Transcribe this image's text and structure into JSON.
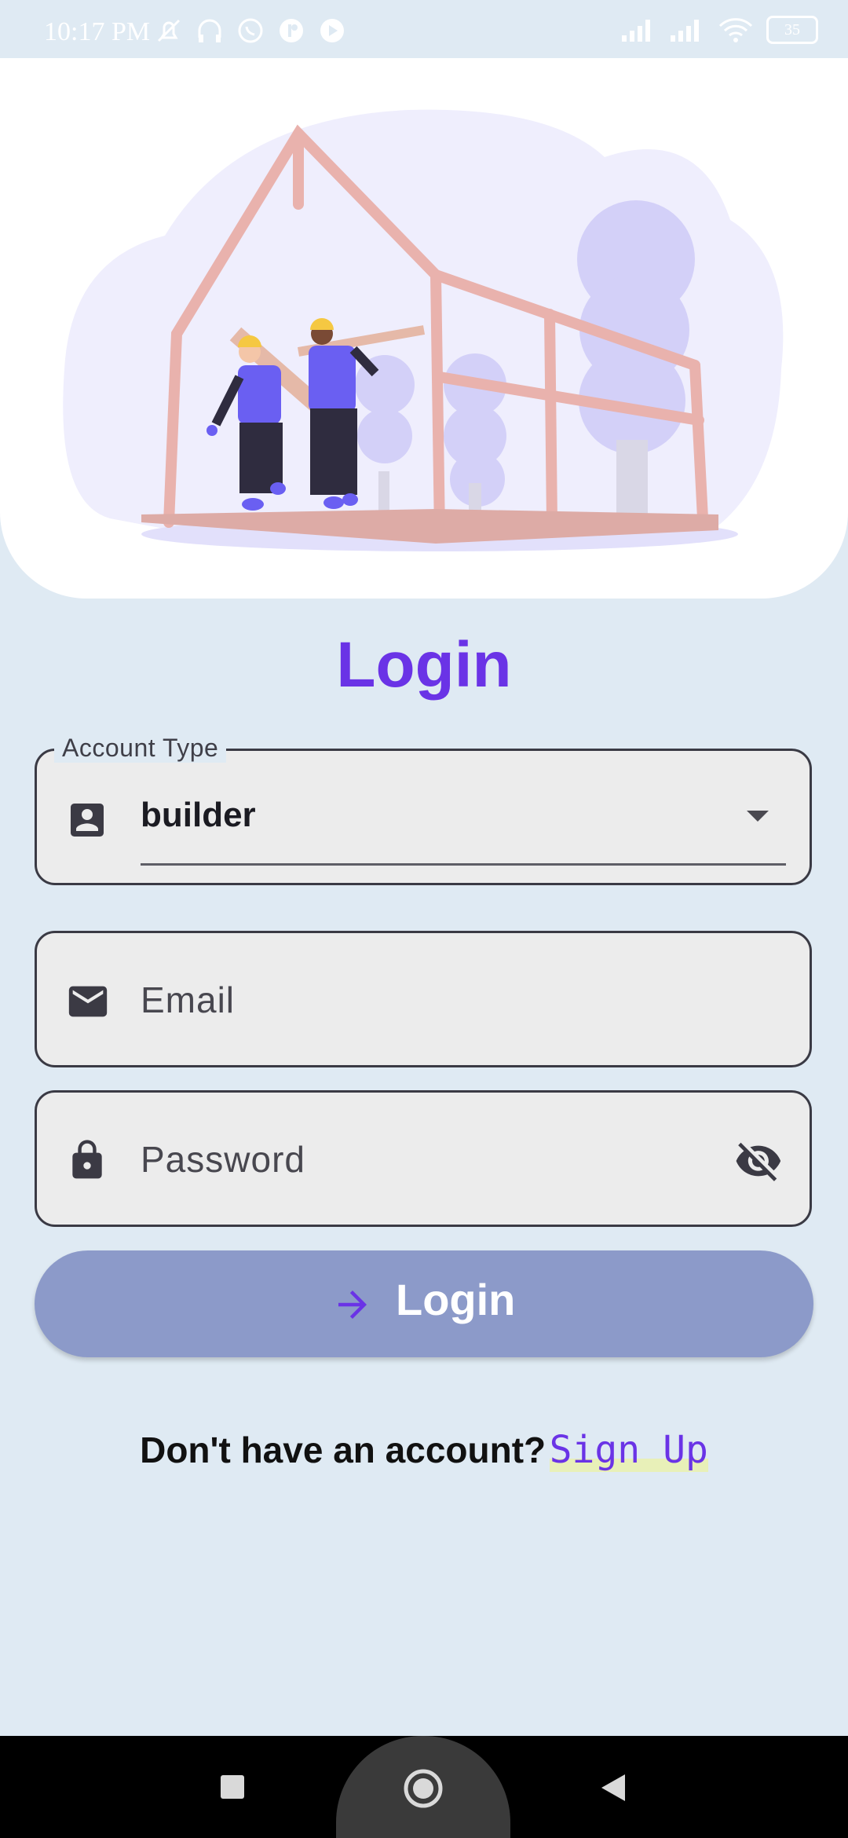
{
  "status_bar": {
    "time": "10:17 PM",
    "battery": "35",
    "left_icons": [
      "mute-icon",
      "headphones-icon",
      "whatsapp-icon",
      "app-icon",
      "youtube-icon"
    ],
    "right_icons": [
      "signal-icon",
      "signal-icon",
      "wifi-icon",
      "battery-icon"
    ]
  },
  "screen": {
    "title": "Login",
    "account_type": {
      "label": "Account Type",
      "value": "builder",
      "icon": "account-box-icon"
    },
    "email": {
      "placeholder": "Email",
      "icon": "mail-icon"
    },
    "password": {
      "placeholder": "Password",
      "icon": "lock-icon",
      "toggle_icon": "visibility-off-icon"
    },
    "login_button": {
      "label": "Login",
      "icon": "arrow-right-icon"
    },
    "signup": {
      "prompt": "Don't have an account?",
      "link": "Sign Up"
    }
  },
  "colors": {
    "accent": "#6a33e6",
    "background": "#dfeaf3",
    "button": "#8c9ac9",
    "field": "#ececec"
  },
  "nav_bar": {
    "buttons": [
      "recents-icon",
      "home-icon",
      "back-icon"
    ]
  }
}
